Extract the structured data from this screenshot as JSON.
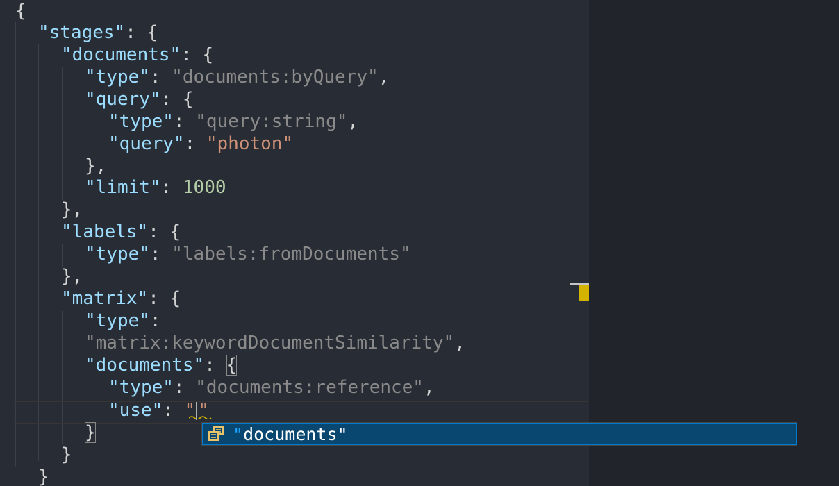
{
  "code": {
    "l1_open": "{",
    "stages_key": "\"stages\"",
    "documents_key": "\"documents\"",
    "type_key": "\"type\"",
    "doc_type_val": "\"documents:byQuery\"",
    "query_key": "\"query\"",
    "query_type_val": "\"query:string\"",
    "query_val": "\"photon\"",
    "limit_key": "\"limit\"",
    "limit_val": "1000",
    "labels_key": "\"labels\"",
    "labels_type_val": "\"labels:fromDocuments\"",
    "matrix_key": "\"matrix\"",
    "matrix_type_val": "\"matrix:keywordDocumentSimilarity\"",
    "ref_type_val": "\"documents:reference\"",
    "use_key": "\"use\"",
    "use_val_open": "\""
  },
  "autocomplete": {
    "icon": "snippet-value-icon",
    "quote_open": "\"",
    "item_text": "documents\""
  },
  "colors": {
    "background": "#282c34",
    "selection": "#094771",
    "key": "#9cdcfe",
    "string_value": "#ce9178",
    "number": "#b5cea8",
    "warning_marker": "#d4b300"
  }
}
